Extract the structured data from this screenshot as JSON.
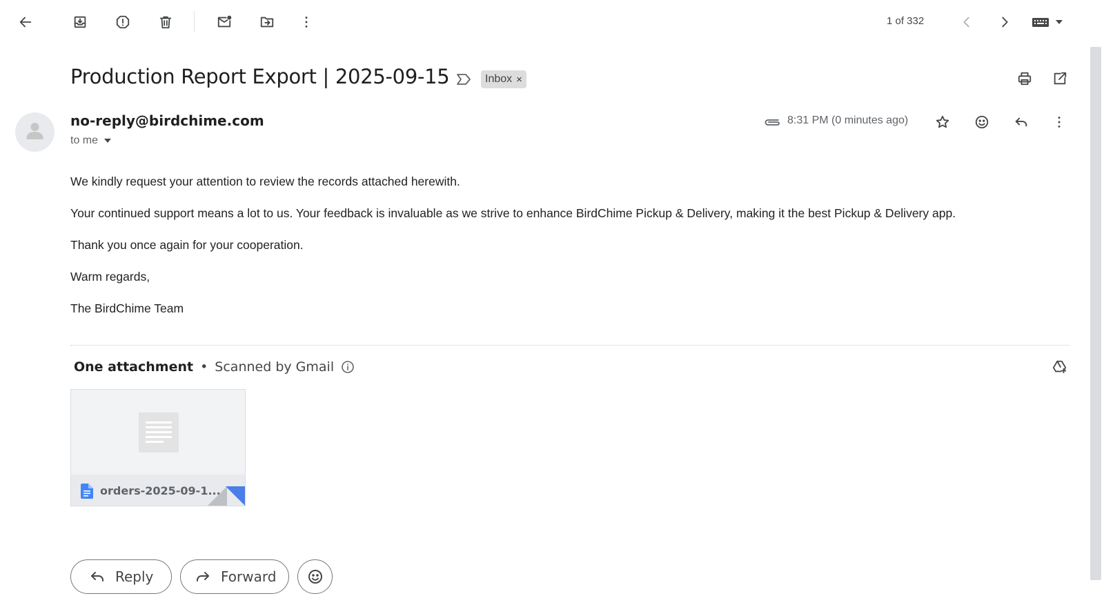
{
  "toolbar": {
    "back_icon": "arrow-left-icon",
    "archive_icon": "archive-icon",
    "report_spam_icon": "report-spam-icon",
    "delete_icon": "trash-icon",
    "mark_unread_icon": "mail-unread-icon",
    "move_to_icon": "folder-move-icon",
    "more_icon": "more-vertical-icon",
    "counter": "1 of 332",
    "input_tools_icon": "keyboard-icon"
  },
  "email": {
    "subject": "Production Report Export | 2025-09-15",
    "label": "Inbox",
    "label_remove": "×",
    "sender": "no-reply@birdchime.com",
    "recipient": "to me",
    "time": "8:31 PM (0 minutes ago)",
    "body": [
      "We kindly request your attention to review the records attached herewith.",
      "Your continued support means a lot to us. Your feedback is invaluable as we strive to enhance BirdChime Pickup & Delivery, making it the best Pickup & Delivery app.",
      "Thank you once again for your cooperation.",
      "Warm regards,",
      "The BirdChime Team"
    ]
  },
  "attachments": {
    "title": "One attachment",
    "separator": "•",
    "scanned": "Scanned by Gmail",
    "file_name": "orders-2025-09-1..."
  },
  "actions": {
    "reply": "Reply",
    "forward": "Forward"
  },
  "colors": {
    "accent_blue": "#4a7ee8",
    "doc_icon_blue": "#4285f4"
  }
}
